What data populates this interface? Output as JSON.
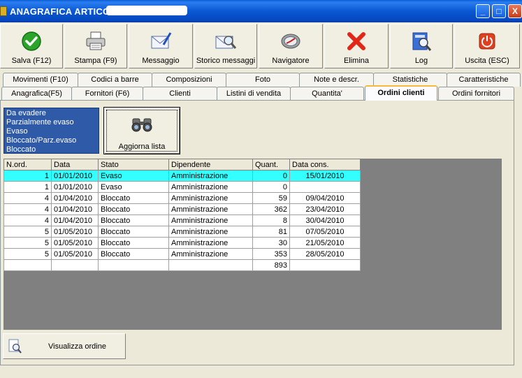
{
  "window": {
    "title": "ANAGRAFICA ARTICOLI",
    "minimize": "_",
    "maximize": "□",
    "close": "X"
  },
  "toolbar": {
    "save": "Salva (F12)",
    "print": "Stampa (F9)",
    "message": "Messaggio",
    "history": "Storico messaggi",
    "navigator": "Navigatore",
    "delete": "Elimina",
    "log": "Log",
    "exit": "Uscita (ESC)"
  },
  "tabs_row1": [
    "Movimenti (F10)",
    "Codici a barre",
    "Composizioni",
    "Foto",
    "Note e descr.",
    "Statistiche",
    "Caratteristiche"
  ],
  "tabs_row2": [
    "Anagrafica(F5)",
    "Fornitori (F6)",
    "Clienti",
    "Listini di vendita",
    "Quantita'",
    "Ordini clienti",
    "Ordini fornitori"
  ],
  "status_filter": [
    "Da evadere",
    "Parzialmente evaso",
    "Evaso",
    "Bloccato/Parz.evaso",
    "Bloccato"
  ],
  "refresh_button": "Aggiorna lista",
  "view_order_button": "Visualizza ordine",
  "table": {
    "headers": [
      "N.ord.",
      "Data",
      "Stato",
      "Dipendente",
      "Quant.",
      "Data cons."
    ],
    "rows": [
      [
        "1",
        "01/01/2010",
        "Evaso",
        "Amministrazione",
        "0",
        "15/01/2010"
      ],
      [
        "1",
        "01/01/2010",
        "Evaso",
        "Amministrazione",
        "0",
        ""
      ],
      [
        "4",
        "01/04/2010",
        "Bloccato",
        "Amministrazione",
        "59",
        "09/04/2010"
      ],
      [
        "4",
        "01/04/2010",
        "Bloccato",
        "Amministrazione",
        "362",
        "23/04/2010"
      ],
      [
        "4",
        "01/04/2010",
        "Bloccato",
        "Amministrazione",
        "8",
        "30/04/2010"
      ],
      [
        "5",
        "01/05/2010",
        "Bloccato",
        "Amministrazione",
        "81",
        "07/05/2010"
      ],
      [
        "5",
        "01/05/2010",
        "Bloccato",
        "Amministrazione",
        "30",
        "21/05/2010"
      ],
      [
        "5",
        "01/05/2010",
        "Bloccato",
        "Amministrazione",
        "353",
        "28/05/2010"
      ]
    ],
    "total": "893",
    "selected_row": 0,
    "selected_color": "#33ffff"
  }
}
